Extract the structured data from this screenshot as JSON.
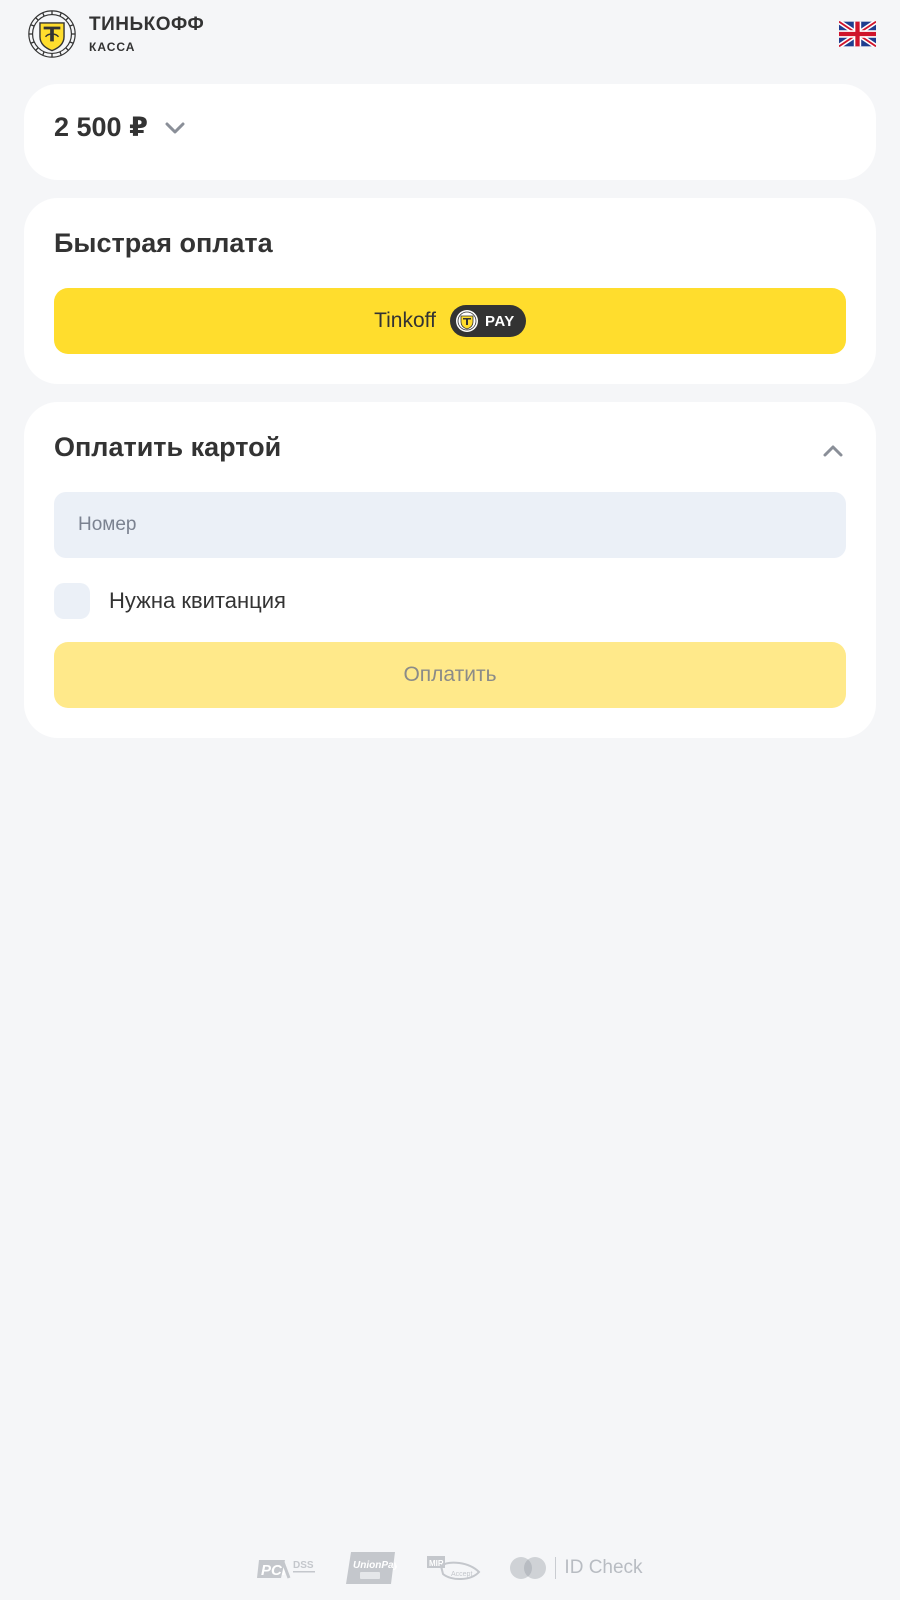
{
  "header": {
    "brand_name": "ТИНЬКОФФ",
    "brand_sub": "КАССА",
    "logo_icon": "tinkoff-crest-icon",
    "language_icon": "uk-flag-icon"
  },
  "amount": {
    "value": "2 500 ₽",
    "toggle_icon": "chevron-down-icon"
  },
  "fast_payment": {
    "title": "Быстрая оплата",
    "tpay_brand": "Tinkoff",
    "tpay_badge": "PAY"
  },
  "card_payment": {
    "title": "Оплатить картой",
    "collapse_icon": "chevron-up-icon",
    "number_placeholder": "Номер",
    "receipt_label": "Нужна квитанция",
    "pay_button": "Оплатить"
  },
  "footer": {
    "logos": [
      "pci-dss-logo",
      "unionpay-logo",
      "mir-accept-logo",
      "mastercard-id-check-logo"
    ],
    "id_check_text": "ID Check"
  },
  "colors": {
    "background": "#f5f6f8",
    "card": "#ffffff",
    "accent_yellow": "#ffdd2d",
    "disabled_yellow": "#ffe98a",
    "input_bg": "#ebf0f7",
    "text": "#333333"
  }
}
